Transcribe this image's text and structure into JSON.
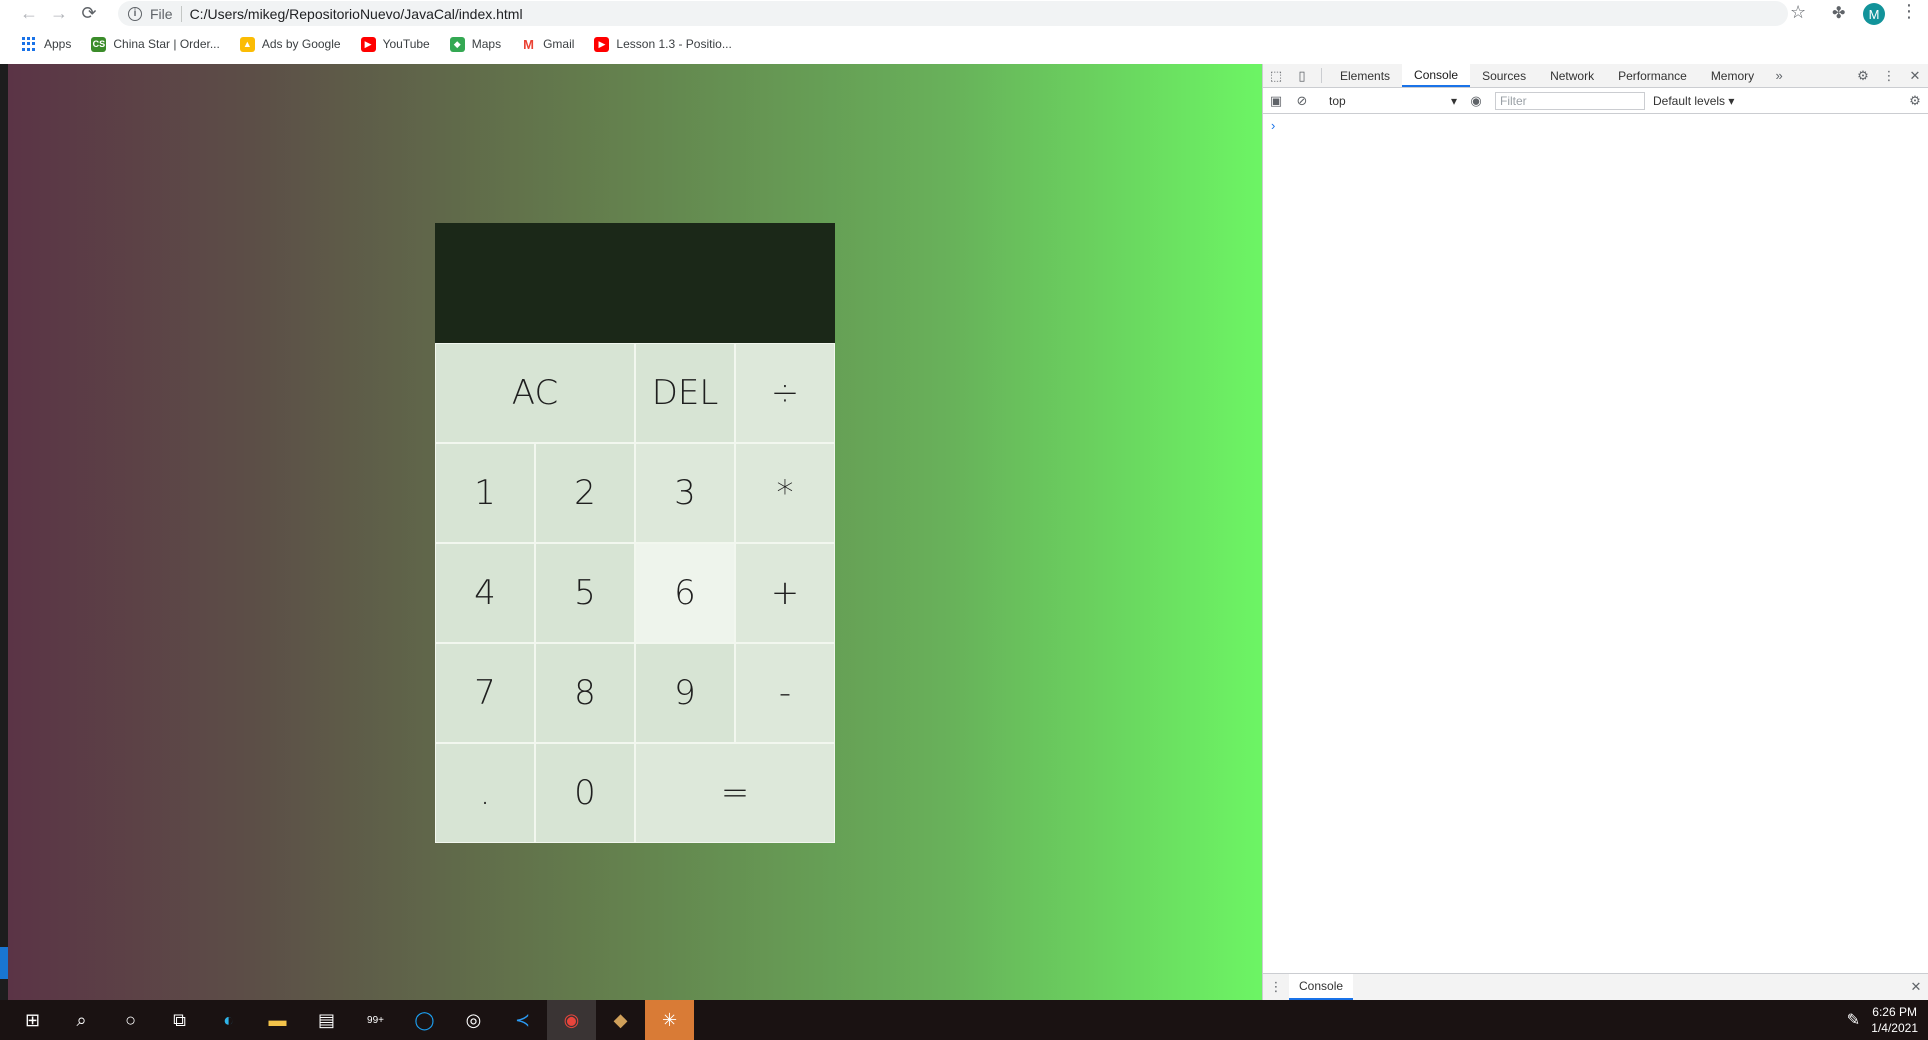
{
  "browser": {
    "url": "C:/Users/mikeg/RepositorioNuevo/JavaCal/index.html",
    "scheme_label": "File",
    "profile_initial": "M",
    "bookmarks": [
      {
        "label": "Apps",
        "icon": "apps-grid-icon"
      },
      {
        "label": "China Star | Order...",
        "icon": "china-star-icon",
        "color": "#3b8c2a"
      },
      {
        "label": "Ads by Google",
        "icon": "google-ads-icon",
        "color": "#fbbc04"
      },
      {
        "label": "YouTube",
        "icon": "youtube-icon",
        "color": "#ff0000"
      },
      {
        "label": "Maps",
        "icon": "maps-icon",
        "color": "#34a853"
      },
      {
        "label": "Gmail",
        "icon": "gmail-icon",
        "color": "#ea4335"
      },
      {
        "label": "Lesson 1.3 - Positio...",
        "icon": "youtube-icon",
        "color": "#ff0000"
      }
    ]
  },
  "calculator": {
    "display_value": "",
    "keys": [
      "AC",
      "DEL",
      "÷",
      "1",
      "2",
      "3",
      "*",
      "4",
      "5",
      "6",
      "+",
      "7",
      "8",
      "9",
      "-",
      ".",
      "0",
      "="
    ]
  },
  "devtools": {
    "tabs": [
      "Elements",
      "Console",
      "Sources",
      "Network",
      "Performance",
      "Memory"
    ],
    "active_tab": "Console",
    "context": "top",
    "filter_placeholder": "Filter",
    "levels": "Default levels ▾",
    "drawer_tab": "Console"
  },
  "taskbar": {
    "time": "6:26 PM",
    "date": "1/4/2021",
    "mail_badge": "99+"
  },
  "colors": {
    "accent": "#1a73e8",
    "display_bg": "#1b2818",
    "key_bg": "#d7e4d4",
    "gradient_left": "#5b3446",
    "gradient_right": "#6cf564"
  }
}
